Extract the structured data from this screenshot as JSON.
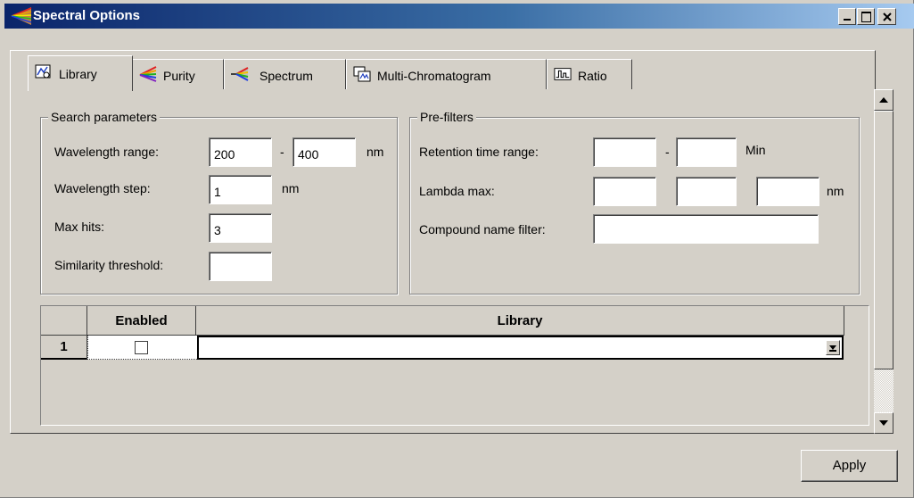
{
  "window": {
    "title": "Spectral Options"
  },
  "tabs": [
    {
      "label": "Library",
      "icon": "library-icon",
      "active": true
    },
    {
      "label": "Purity",
      "icon": "purity-icon"
    },
    {
      "label": "Spectrum",
      "icon": "spectrum-icon"
    },
    {
      "label": "Multi-Chromatogram",
      "icon": "multi-chromatogram-icon"
    },
    {
      "label": "Ratio",
      "icon": "ratio-icon"
    }
  ],
  "search_parameters": {
    "legend": "Search parameters",
    "wavelength_range_label": "Wavelength range:",
    "wavelength_from": "200",
    "range_separator": "-",
    "wavelength_to": "400",
    "nm_unit": "nm",
    "wavelength_step_label": "Wavelength step:",
    "wavelength_step": "1",
    "step_unit": "nm",
    "max_hits_label": "Max hits:",
    "max_hits": "3",
    "similarity_label": "Similarity threshold:",
    "similarity": ""
  },
  "pre_filters": {
    "legend": "Pre-filters",
    "rt_label": "Retention time range:",
    "rt_from": "",
    "rt_separator": "-",
    "rt_to": "",
    "rt_unit": "Min",
    "lambda_label": "Lambda max:",
    "lambda_1": "",
    "lambda_2": "",
    "lambda_3": "",
    "lambda_unit": "nm",
    "compound_label": "Compound name filter:",
    "compound": ""
  },
  "library_table": {
    "headers": [
      "Enabled",
      "Library"
    ],
    "rows": [
      {
        "index": "1",
        "enabled": false,
        "library": ""
      }
    ]
  },
  "buttons": {
    "apply": "Apply"
  },
  "colors": {
    "titlebar_start": "#0a246a",
    "titlebar_end": "#a6caf0",
    "face": "#d4d0c8"
  }
}
